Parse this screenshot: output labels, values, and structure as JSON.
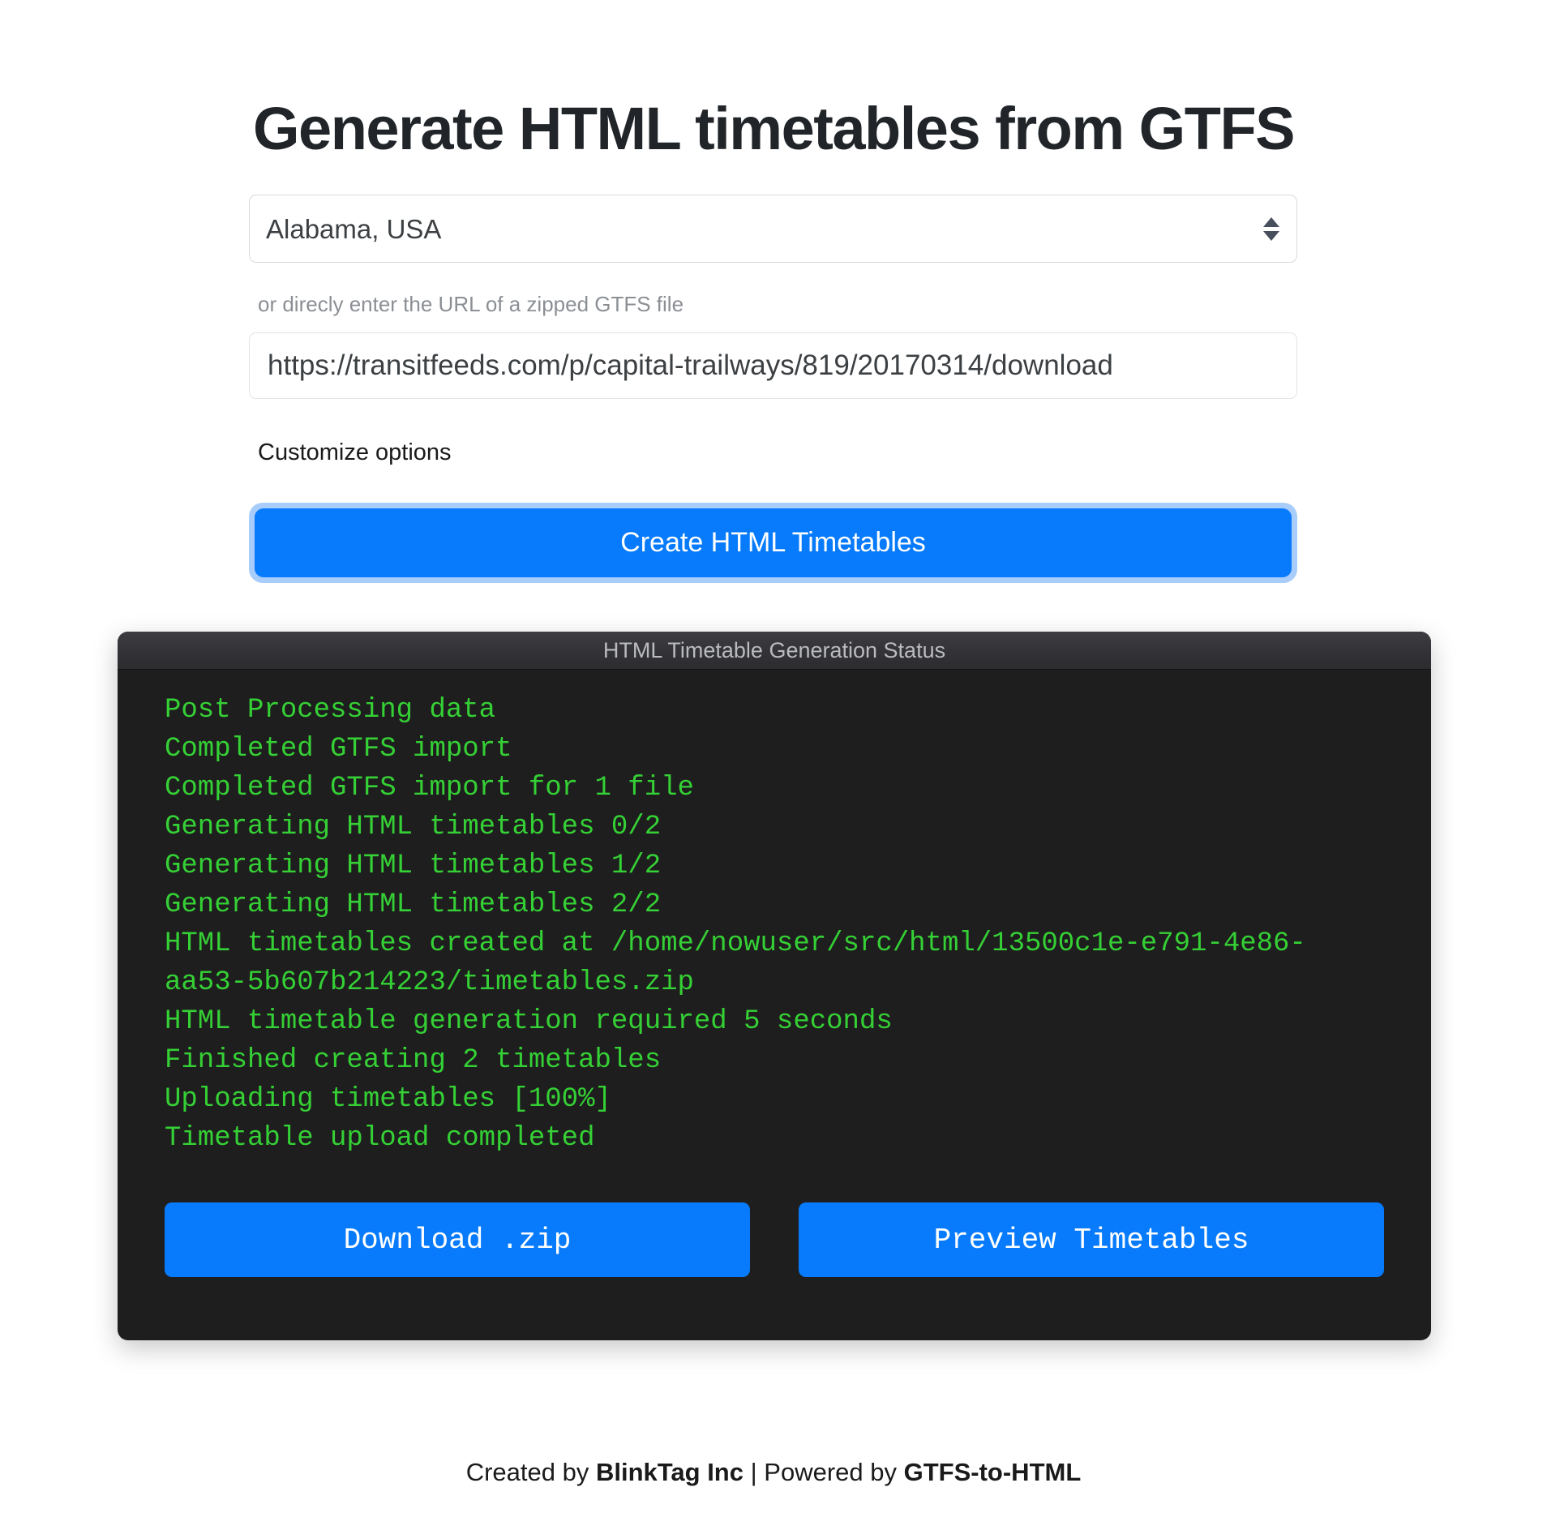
{
  "page": {
    "title": "Generate HTML timetables from GTFS"
  },
  "form": {
    "feed_select": {
      "selected": "Alabama, USA",
      "options": [
        "Alabama, USA"
      ],
      "stepper_icon": "stepper-updown-icon"
    },
    "url_label": "or direcly enter the URL of a zipped GTFS file",
    "url_input": {
      "value": "https://transitfeeds.com/p/capital-trailways/819/20170314/download",
      "placeholder": "https://"
    },
    "customize_options_label": "Customize options",
    "create_button_label": "Create HTML Timetables"
  },
  "terminal": {
    "title": "HTML Timetable Generation Status",
    "log_lines": [
      "Post Processing data",
      "Completed GTFS import",
      "Completed GTFS import for 1 file",
      "Generating HTML timetables 0/2",
      "Generating HTML timetables 1/2",
      "Generating HTML timetables 2/2",
      "HTML timetables created at /home/nowuser/src/html/13500c1e-e791-4e86-aa53-5b607b214223/timetables.zip",
      "HTML timetable generation required 5 seconds",
      "Finished creating 2 timetables",
      "Uploading timetables [100%]",
      "Timetable upload completed"
    ],
    "download_button_label": "Download .zip",
    "preview_button_label": "Preview Timetables"
  },
  "footer": {
    "created_by_prefix": "Created by ",
    "created_by_link": "BlinkTag Inc",
    "separator": " | ",
    "powered_by_prefix": "Powered by ",
    "powered_by_link": "GTFS-to-HTML"
  },
  "colors": {
    "accent_blue": "#077bfb",
    "focus_ring": "#a9cdfa",
    "terminal_bg": "#1e1e1e",
    "terminal_green": "#35d035",
    "titlebar_text": "#b9bbbe"
  }
}
